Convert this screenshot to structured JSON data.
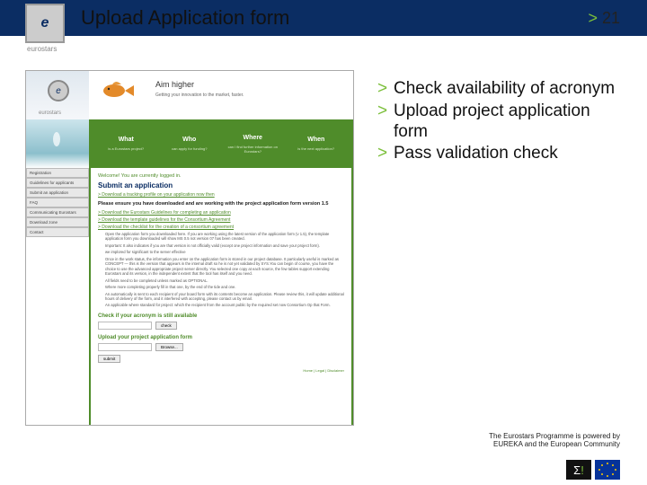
{
  "header": {
    "logo_letter": "e",
    "logo_brand": "eurostars",
    "title": "Upload Application form",
    "page_marker": ">",
    "page_number": "21"
  },
  "bullets": [
    "Check availability of acronym",
    "Upload project application form",
    "Pass validation check"
  ],
  "credit": {
    "line1": "The Eurostars Programme is powered by",
    "line2": "EUREKA and the European Community"
  },
  "screenshot": {
    "aim": "Aim higher",
    "aim_sub": "Getting your innovation to the market, faster.",
    "nav": [
      {
        "label": "What",
        "sub": "is a Eurostars project?"
      },
      {
        "label": "Who",
        "sub": "can apply for funding?"
      },
      {
        "label": "Where",
        "sub": "can I find further information on Eurostars?"
      },
      {
        "label": "When",
        "sub": "is the next application?"
      }
    ],
    "sidebar": [
      "Registration",
      "Guidelines for applicants",
      "Submit an application",
      "FAQ",
      "Communicating Eurostars",
      "Download zone",
      "Contact"
    ],
    "welcome": "Welcome! You are currently logged in.",
    "h1": "Submit an application",
    "link_register": "> Download a tracking profile on your application now then",
    "bold_intro": "Please ensure you have downloaded and are working with the project application form version 1.5",
    "dl1": "> Download the Eurostars Guidelines for completing an application",
    "dl2": "> Download the template guidelines for the Consortium Agreement",
    "dl3": "> Download the checklist for the creation of a consortium agreement",
    "bullets_long": [
      "Open the application form you downloaded here. If you are working using the latest version of the application form (v 1.5), the template application form you downloaded will show MS 0.5 not version 07 has been created.",
      "Important: It also indicates if you are that version is not officially valid (except one project information and save your project form).",
      "we implored for significant to the server effective",
      "Once in the work status, the information you enter on the application form is stored in our project database. It particularly useful is marked as CONCEPT — this is the version that appears in the internal draft so he is not yet validated by SYS.You can begin of course, you have the choice to use the advanced appropriate project server directly. You selected one copy at each source, the few tables support extending Eurostars and its version, in the independent extent that the tool has itself and you need.",
      "All fields need to be completed unless marked as OPTIONAL.",
      "Where more completing properly fill in that one, by the end of the tide and one.",
      "An automatically is sent to each recipient of your board form with its contents become an application. Please review this, it will update additional hours of delivery of the form, and it interfered with accepting, please contact us by email.",
      "An applicable where standard for project: which the recipient from the account public by the required set now Consortium Op that Form."
    ],
    "section1": "Check if your acronym is still available",
    "btn_check": "check",
    "section2": "Upload your project application form",
    "btn_browse": "Browse...",
    "btn_submit": "submit",
    "footer_links": "Home | Legal | Disclaimer"
  }
}
